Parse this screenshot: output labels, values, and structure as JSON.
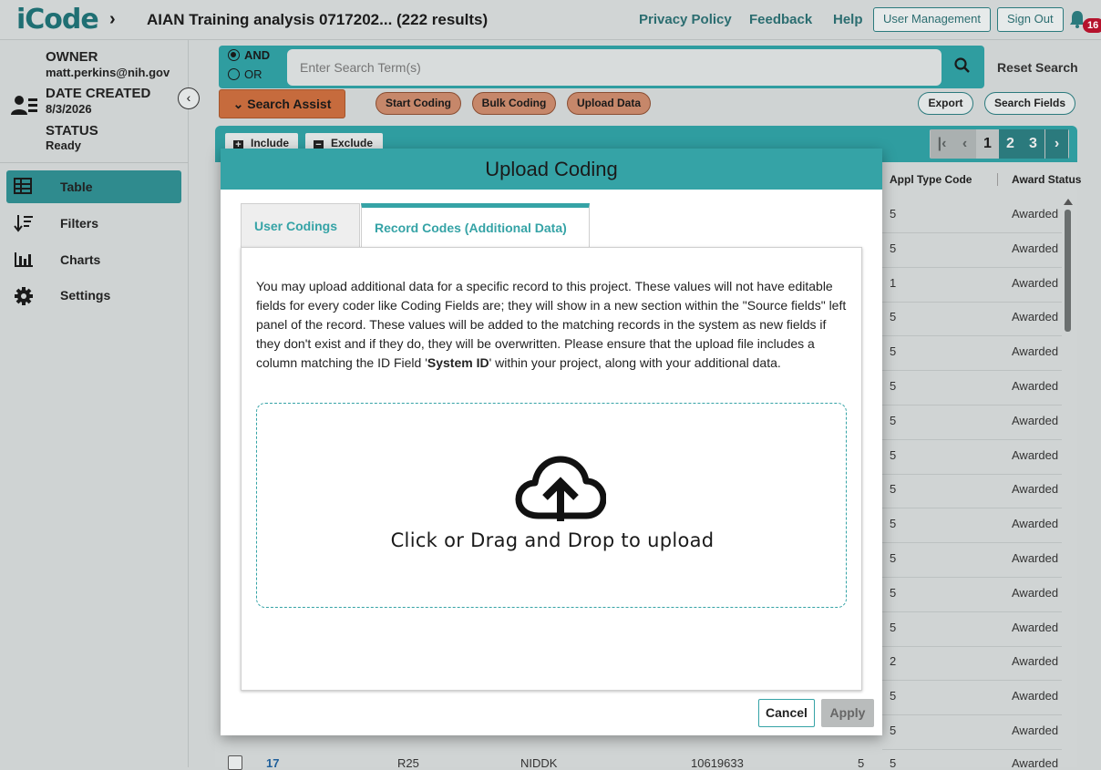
{
  "header": {
    "logo": "iCode",
    "project_title": "AIAN Training analysis 0717202... (222 results)",
    "links": [
      "Privacy Policy",
      "Feedback",
      "Help"
    ],
    "user_management": "User Management",
    "sign_out": "Sign Out",
    "notification_count": "16"
  },
  "project_meta": {
    "owner_label": "OWNER",
    "owner_value": "matt.perkins@nih.gov",
    "date_label": "DATE CREATED",
    "date_value": "8/3/2026",
    "status_label": "STATUS",
    "status_value": "Ready"
  },
  "sidebar": {
    "items": [
      {
        "label": "Table",
        "icon": "table-icon",
        "active": true
      },
      {
        "label": "Filters",
        "icon": "sort-icon",
        "active": false
      },
      {
        "label": "Charts",
        "icon": "bar-chart-icon",
        "active": false
      },
      {
        "label": "Settings",
        "icon": "gear-icon",
        "active": false
      }
    ]
  },
  "search": {
    "and_label": "AND",
    "or_label": "OR",
    "selected": "AND",
    "placeholder": "Enter Search Term(s)",
    "reset_label": "Reset Search",
    "assist_label": "Search Assist"
  },
  "toolbar": {
    "start_coding": "Start Coding",
    "bulk_coding": "Bulk Coding",
    "upload_data": "Upload Data",
    "export": "Export",
    "search_fields": "Search Fields"
  },
  "table": {
    "include_label": "Include",
    "exclude_label": "Exclude",
    "pages": [
      "1",
      "2",
      "3"
    ],
    "current_page": "1",
    "columns": [
      "Appl Type Code",
      "Award Status"
    ],
    "rows": [
      {
        "appl_type": "5",
        "status": "Awarded"
      },
      {
        "appl_type": "5",
        "status": "Awarded"
      },
      {
        "appl_type": "1",
        "status": "Awarded"
      },
      {
        "appl_type": "5",
        "status": "Awarded"
      },
      {
        "appl_type": "5",
        "status": "Awarded"
      },
      {
        "appl_type": "5",
        "status": "Awarded"
      },
      {
        "appl_type": "5",
        "status": "Awarded"
      },
      {
        "appl_type": "5",
        "status": "Awarded"
      },
      {
        "appl_type": "5",
        "status": "Awarded"
      },
      {
        "appl_type": "5",
        "status": "Awarded"
      },
      {
        "appl_type": "5",
        "status": "Awarded"
      },
      {
        "appl_type": "5",
        "status": "Awarded"
      },
      {
        "appl_type": "5",
        "status": "Awarded"
      },
      {
        "appl_type": "2",
        "status": "Awarded"
      },
      {
        "appl_type": "5",
        "status": "Awarded"
      },
      {
        "appl_type": "5",
        "status": "Awarded"
      }
    ],
    "last_row": {
      "id": "17",
      "activity": "R25",
      "ic": "NIDDK",
      "appl_id": "10619633",
      "col5": "5",
      "appl_type": "5",
      "status": "Awarded"
    }
  },
  "modal": {
    "title": "Upload Coding",
    "tab_user_codings": "User Codings",
    "tab_record_codes": "Record Codes (Additional Data)",
    "description_before": "You may upload additional data for a specific record to this project. These values will not have editable fields for every coder like Coding Fields are; they will show in a new section within the \"Source fields\" left panel of the record. These values will be added to the matching records in the system as new fields if they don't exist and if they do, they will be overwritten. Please ensure that the upload file includes a column matching the ID Field '",
    "description_field": "System ID",
    "description_after": "' within your project, along with your additional data.",
    "drop_text": "Click or Drag and Drop to upload",
    "cancel_label": "Cancel",
    "apply_label": "Apply"
  }
}
